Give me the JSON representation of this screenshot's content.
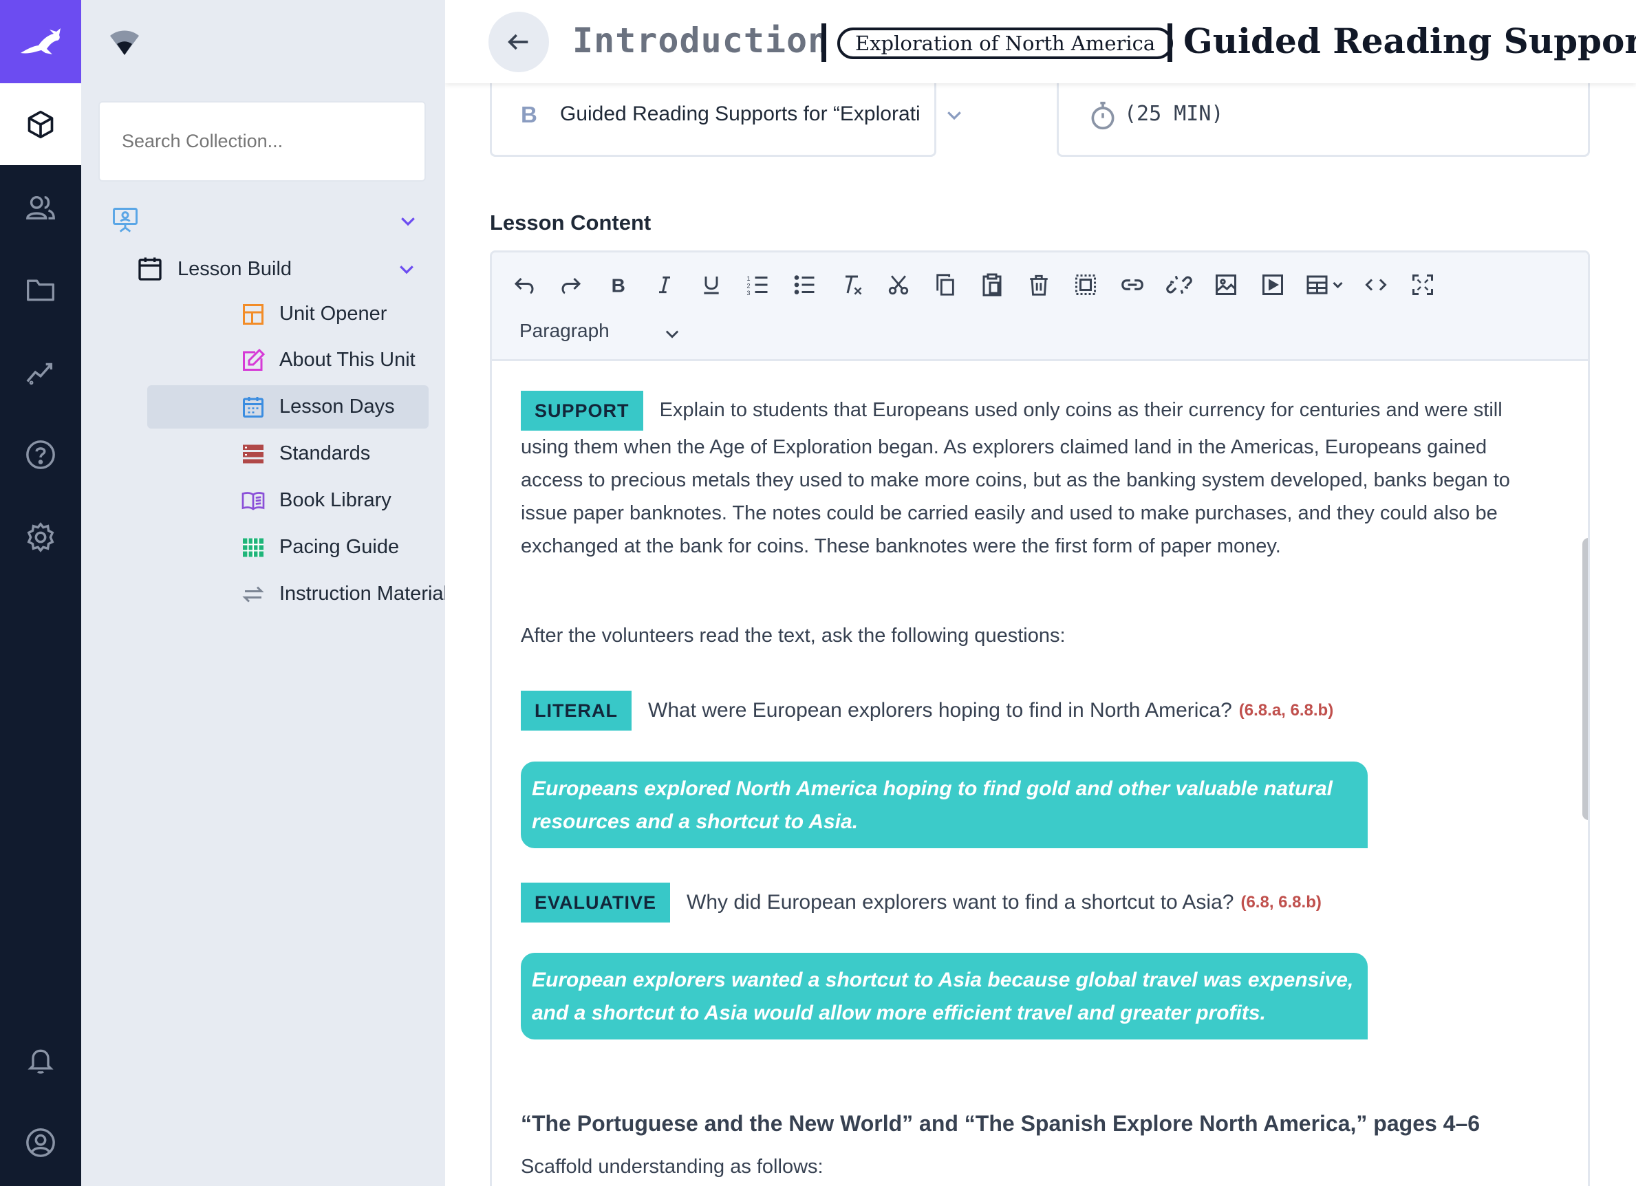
{
  "rail": {
    "items": [
      "collection-icon",
      "users-icon",
      "folder-icon",
      "analytics-icon",
      "help-icon",
      "settings-icon",
      "bell-icon",
      "account-icon"
    ],
    "active": "collection-icon"
  },
  "panel": {
    "search_placeholder": "Search Collection...",
    "tree_build_label": "Lesson Build",
    "items": [
      {
        "label": "Unit Opener",
        "icon": "layout-icon",
        "color": "#f28c28"
      },
      {
        "label": "About This Unit",
        "icon": "edit-icon",
        "color": "#d63ad6"
      },
      {
        "label": "Lesson Days",
        "icon": "calendar-icon",
        "color": "#3b8de0"
      },
      {
        "label": "Standards",
        "icon": "list-icon",
        "color": "#b04848"
      },
      {
        "label": "Book Library",
        "icon": "book-icon",
        "color": "#8a4fd8"
      },
      {
        "label": "Pacing Guide",
        "icon": "grid-icon",
        "color": "#1fb57a"
      },
      {
        "label": "Instruction Materials",
        "icon": "swap-icon",
        "color": "#7c8594"
      }
    ],
    "active_item": "Lesson Days"
  },
  "header": {
    "section": "Introduction",
    "unit_pill": "Exploration of North America",
    "title": "Guided Reading Supports for “Exploration of North America”"
  },
  "cards": {
    "letter": "B",
    "section_select": "Guided Reading Supports for “Explorati",
    "duration": "(25 MIN)"
  },
  "editor": {
    "heading": "Lesson Content",
    "paragraph_style": "Paragraph",
    "toolbar": [
      "undo-icon",
      "redo-icon",
      "bold-icon",
      "italic-icon",
      "underline-icon",
      "ordered-list-icon",
      "bullet-list-icon",
      "clear-format-icon",
      "cut-icon",
      "copy-icon",
      "paste-icon",
      "delete-icon",
      "select-all-icon",
      "link-icon",
      "unlink-icon",
      "image-icon",
      "video-icon",
      "table-icon",
      "code-icon",
      "fullscreen-icon"
    ]
  },
  "content": {
    "support_tag": "SUPPORT",
    "support_text": "Explain to students that Europeans used only coins as their currency for centuries and were still using them when the Age of Exploration began. As explorers claimed land in the Americas, Europeans gained access to precious metals they used to make more coins, but as the banking system developed, banks began to issue paper banknotes. The notes could be carried easily and used to make purchases, and they could also be exchanged at the bank for coins. These banknotes were the first form of paper money.",
    "after_text": "After the volunteers read the text, ask the following questions:",
    "q1": {
      "tag": "LITERAL",
      "text": "What were European explorers hoping to find in North America?",
      "standards": "(6.8.a, 6.8.b)",
      "answer": "Europeans explored North America hoping to find gold and other valuable natural resources and a shortcut to Asia."
    },
    "q2": {
      "tag": "EVALUATIVE",
      "text": "Why did European explorers want to find a shortcut to Asia?",
      "standards": "(6.8, 6.8.b)",
      "answer": "European explorers wanted a shortcut to Asia because global travel was expensive, and a shortcut to Asia would allow more efficient travel and greater profits."
    },
    "reading_heading": "“The Portuguese and the New World” and “The Spanish Explore North America,” pages 4–6",
    "scaffold": "Scaffold understanding as follows:"
  },
  "colors": {
    "brand": "#6c4cf1",
    "rail": "#111b2e",
    "panel": "#e7ebf2",
    "teal": "#38c8c8",
    "standard_red": "#c0504d"
  }
}
